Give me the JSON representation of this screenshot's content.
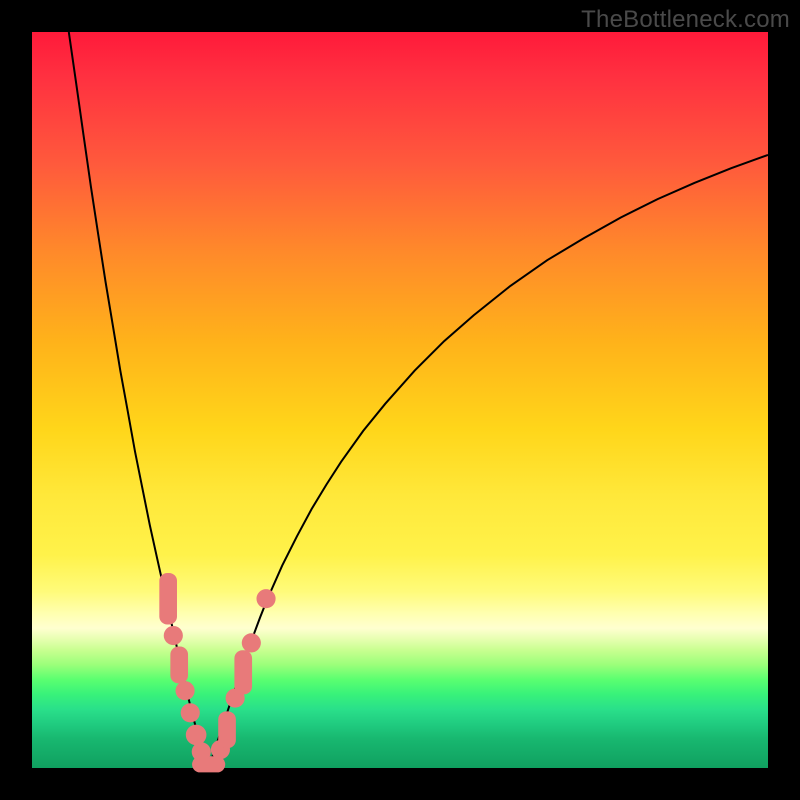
{
  "watermark": "TheBottleneck.com",
  "colors": {
    "frame": "#000000",
    "curve": "#000000",
    "marker": "#e87a7a",
    "gradient_stops": [
      "#ff1a3a",
      "#ff3040",
      "#ff5a3c",
      "#ff8a2a",
      "#ffb21a",
      "#ffd61a",
      "#ffe83a",
      "#fff24a",
      "#fffb7a",
      "#ffffb0",
      "#ffffd0",
      "#e6ffb0",
      "#c8ff90",
      "#9aff7a",
      "#5aff70",
      "#38f27a",
      "#2ae08a",
      "#20cc80",
      "#18b870",
      "#10a060"
    ]
  },
  "chart_data": {
    "type": "line",
    "title": "",
    "xlabel": "",
    "ylabel": "",
    "xlim": [
      0,
      100
    ],
    "ylim": [
      0,
      100
    ],
    "x_min_point": 24,
    "series": [
      {
        "name": "left-branch",
        "x": [
          5,
          6,
          7,
          8,
          9,
          10,
          11,
          12,
          13,
          14,
          15,
          16,
          17,
          18,
          19,
          20,
          21,
          22,
          23,
          24
        ],
        "values": [
          100,
          93,
          86,
          79,
          72.5,
          66,
          60,
          54,
          48.5,
          43,
          38,
          33,
          28.5,
          24,
          19.5,
          15,
          10.5,
          6.5,
          3,
          0
        ]
      },
      {
        "name": "right-branch",
        "x": [
          24,
          25,
          26,
          27,
          28,
          29,
          30,
          31,
          32,
          34,
          36,
          38,
          40,
          42,
          45,
          48,
          52,
          56,
          60,
          65,
          70,
          75,
          80,
          85,
          90,
          95,
          100
        ],
        "values": [
          0,
          3,
          6,
          9,
          12,
          15,
          17.8,
          20.5,
          23,
          27.5,
          31.5,
          35.2,
          38.5,
          41.6,
          45.8,
          49.5,
          54,
          58,
          61.5,
          65.5,
          69,
          72,
          74.8,
          77.3,
          79.5,
          81.5,
          83.3
        ]
      }
    ],
    "markers": {
      "name": "highlighted-points",
      "note": "approximate oval/pill markers along the low part of the V curve",
      "points": [
        {
          "x": 18.5,
          "y": 23,
          "shape": "pill",
          "w": 2.4,
          "h": 7
        },
        {
          "x": 19.2,
          "y": 18,
          "shape": "circle",
          "r": 1.3
        },
        {
          "x": 20.0,
          "y": 14,
          "shape": "pill",
          "w": 2.4,
          "h": 5
        },
        {
          "x": 20.8,
          "y": 10.5,
          "shape": "circle",
          "r": 1.3
        },
        {
          "x": 21.5,
          "y": 7.5,
          "shape": "circle",
          "r": 1.3
        },
        {
          "x": 22.3,
          "y": 4.5,
          "shape": "circle",
          "r": 1.4
        },
        {
          "x": 23.0,
          "y": 2.2,
          "shape": "circle",
          "r": 1.3
        },
        {
          "x": 24.0,
          "y": 0.5,
          "shape": "pill",
          "w": 4.5,
          "h": 2.2
        },
        {
          "x": 25.6,
          "y": 2.5,
          "shape": "circle",
          "r": 1.3
        },
        {
          "x": 26.5,
          "y": 5.2,
          "shape": "pill",
          "w": 2.4,
          "h": 5
        },
        {
          "x": 27.6,
          "y": 9.5,
          "shape": "circle",
          "r": 1.3
        },
        {
          "x": 28.7,
          "y": 13,
          "shape": "pill",
          "w": 2.4,
          "h": 6
        },
        {
          "x": 29.8,
          "y": 17,
          "shape": "circle",
          "r": 1.3
        },
        {
          "x": 31.8,
          "y": 23,
          "shape": "circle",
          "r": 1.3
        }
      ]
    }
  }
}
